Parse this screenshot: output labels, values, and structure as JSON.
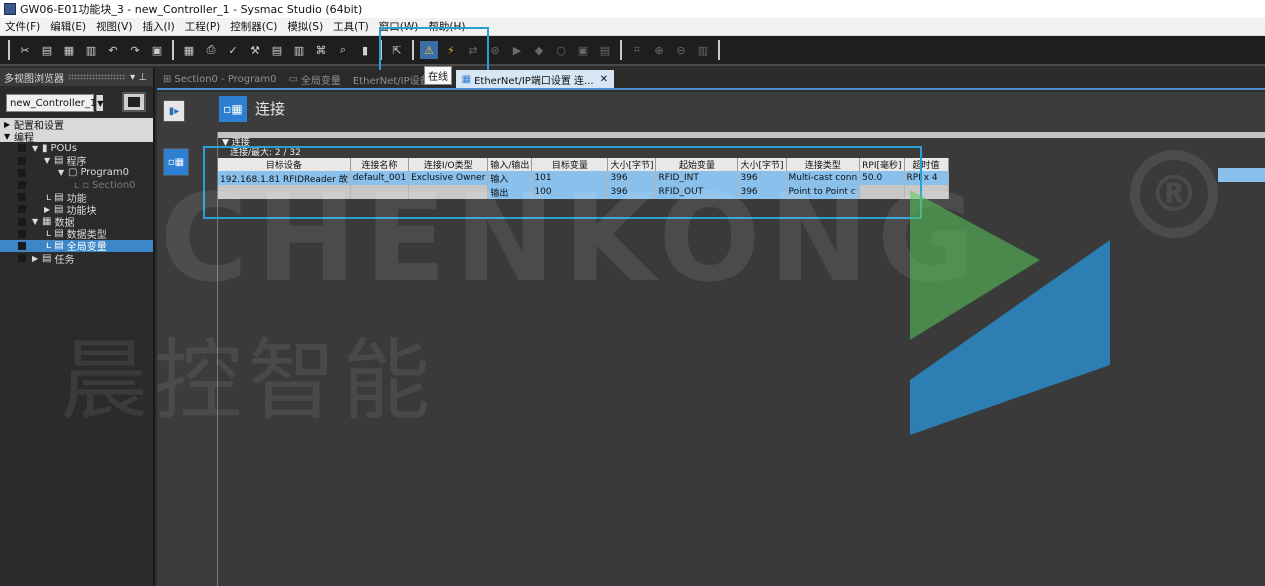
{
  "window": {
    "title": "GW06-E01功能块_3 - new_Controller_1 - Sysmac Studio (64bit)"
  },
  "menu": [
    "文件(F)",
    "编辑(E)",
    "视图(V)",
    "插入(I)",
    "工程(P)",
    "控制器(C)",
    "模拟(S)",
    "工具(T)",
    "窗口(W)",
    "帮助(H)"
  ],
  "tooltip": "在线",
  "left_panel": {
    "header": "多视图浏览器",
    "controller": "new_Controller_1",
    "tree": [
      {
        "label": "配置和设置",
        "kind": "section",
        "expanded": false
      },
      {
        "label": "编程",
        "kind": "section",
        "expanded": true
      },
      {
        "label": "POUs",
        "kind": "item",
        "indent": 1
      },
      {
        "label": "程序",
        "kind": "item",
        "indent": 2
      },
      {
        "label": "Program0",
        "kind": "item",
        "indent": 3
      },
      {
        "label": "Section0",
        "kind": "item",
        "indent": 4,
        "dim": true
      },
      {
        "label": "功能",
        "kind": "item",
        "indent": 2
      },
      {
        "label": "功能块",
        "kind": "item",
        "indent": 2
      },
      {
        "label": "数据",
        "kind": "item",
        "indent": 1
      },
      {
        "label": "数据类型",
        "kind": "item",
        "indent": 2
      },
      {
        "label": "全局变量",
        "kind": "item",
        "indent": 2,
        "selected": true
      },
      {
        "label": "任务",
        "kind": "item",
        "indent": 1
      }
    ]
  },
  "tabs": [
    {
      "label": "Section0 - Program0",
      "active": false
    },
    {
      "label": "全局变量",
      "active": false
    },
    {
      "label": "EtherNet/IP设备列表",
      "active": false
    },
    {
      "label": "EtherNet/IP端口设置 连...",
      "active": true
    }
  ],
  "content": {
    "heading": "连接",
    "panel_title": "连接",
    "count": "连接/最大: 2 / 32",
    "columns": [
      "目标设备",
      "连接名称",
      "连接I/O类型",
      "输入/输出",
      "目标变量",
      "大小[字节]",
      "起始变量",
      "大小[字节]",
      "连接类型",
      "RPI[毫秒]",
      "超时值"
    ],
    "rows": [
      [
        "192.168.1.81 RFIDReader 故",
        "default_001",
        "Exclusive Owner",
        "输入",
        "101",
        "396",
        "RFID_INT",
        "396",
        "Multi-cast conn",
        "50.0",
        "RPI x 4"
      ],
      [
        "",
        "",
        "",
        "输出",
        "100",
        "396",
        "RFID_OUT",
        "396",
        "Point to Point c",
        "",
        ""
      ]
    ]
  },
  "watermark": {
    "brand": "CHENKONG",
    "cn": "晨控智能",
    "mark": "®"
  },
  "colors": {
    "accent_blue": "#2a9fd6",
    "selection_blue": "#3d87c9"
  }
}
